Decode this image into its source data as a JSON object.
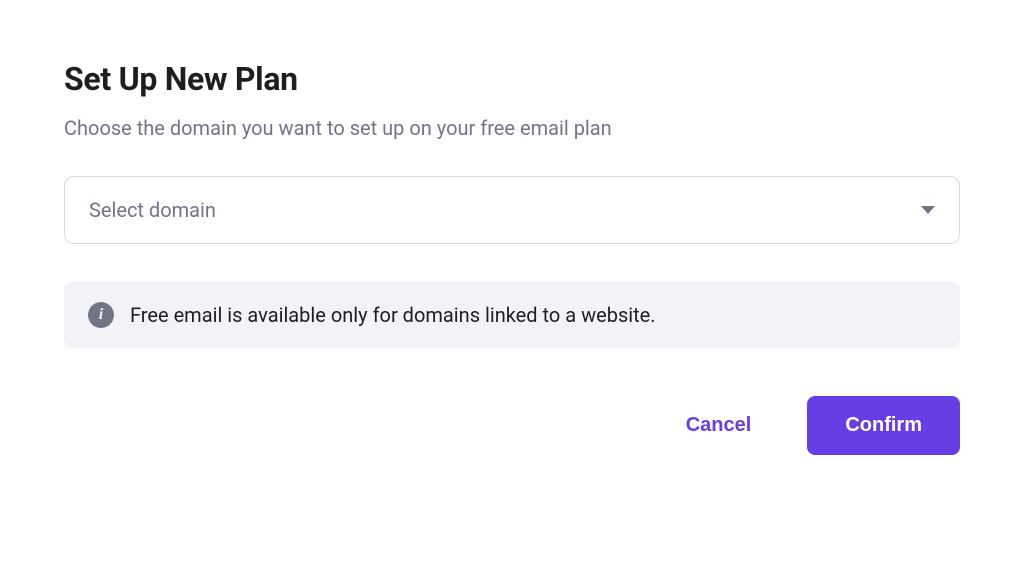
{
  "heading": "Set Up New Plan",
  "subtitle": "Choose the domain you want to set up on your free email plan",
  "select": {
    "placeholder": "Select domain"
  },
  "info": {
    "message": "Free email is available only for domains linked to a website."
  },
  "actions": {
    "cancel": "Cancel",
    "confirm": "Confirm"
  }
}
